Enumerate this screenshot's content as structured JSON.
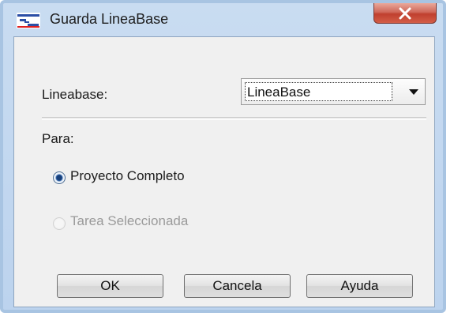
{
  "window": {
    "title": "Guarda LineaBase",
    "close_icon": "close-x-icon"
  },
  "form": {
    "lineabase_label": "Lineabase:",
    "lineabase_value": "LineaBase",
    "para_label": "Para:"
  },
  "options": [
    {
      "label": "Proyecto Completo",
      "checked": true,
      "enabled": true
    },
    {
      "label": "Tarea Seleccionada",
      "checked": false,
      "enabled": false
    }
  ],
  "buttons": {
    "ok": "OK",
    "cancel": "Cancela",
    "help": "Ayuda"
  },
  "colors": {
    "frame": "#bcd3ee",
    "close_button": "#c0402f",
    "dialog_bg": "#f0f0f0"
  }
}
